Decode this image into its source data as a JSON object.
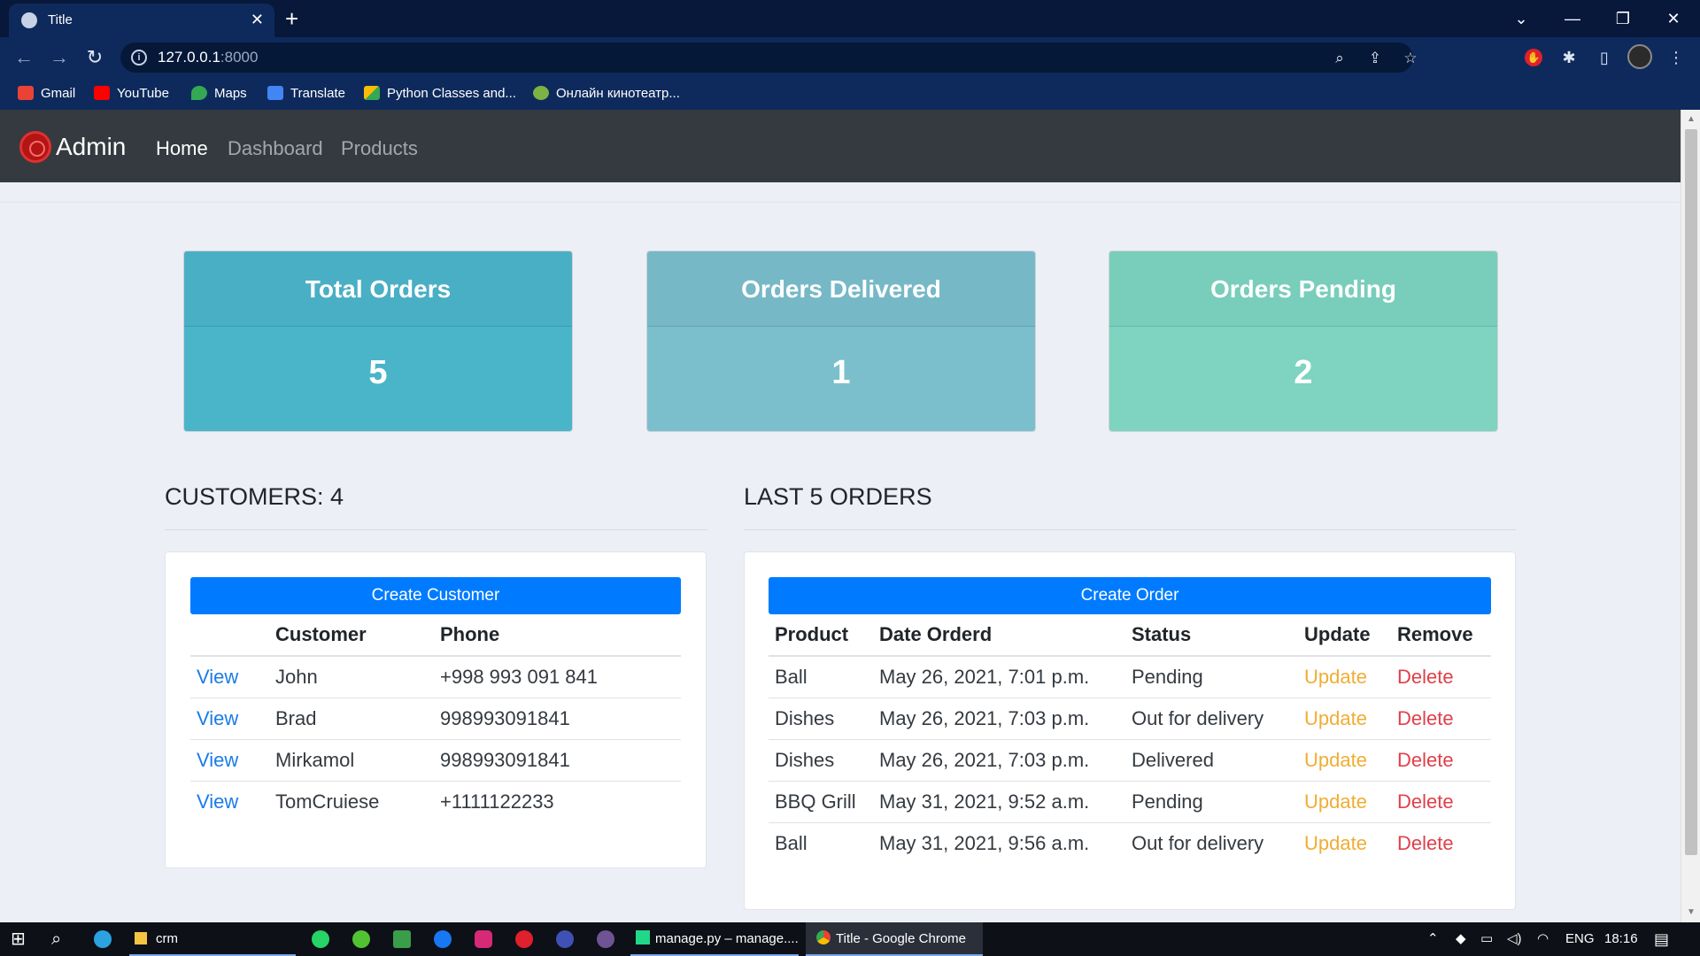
{
  "browser": {
    "tab_title": "Title",
    "tab_close": "✕",
    "new_tab": "+",
    "url_host": "127.0.0.1",
    "url_port": ":8000",
    "window_controls": {
      "dropdown": "⌄",
      "minimize": "—",
      "restore": "❐",
      "close": "✕"
    },
    "bookmarks": [
      {
        "label": "Gmail",
        "icon": "gmail-icon",
        "color": "#ea4335"
      },
      {
        "label": "YouTube",
        "icon": "youtube-icon",
        "color": "#ff0000"
      },
      {
        "label": "Maps",
        "icon": "maps-icon",
        "color": "#34a853"
      },
      {
        "label": "Translate",
        "icon": "translate-icon",
        "color": "#4285f4"
      },
      {
        "label": "Python Classes and...",
        "icon": "python-classes-icon",
        "color": "#fbbc05"
      },
      {
        "label": "Онлайн кинотеатр...",
        "icon": "cinema-icon",
        "color": "#7cb342"
      }
    ]
  },
  "navbar": {
    "brand": "Admin",
    "links": [
      "Home",
      "Dashboard",
      "Products"
    ],
    "active": "Home",
    "bg_color": "#343a40"
  },
  "stats": [
    {
      "title": "Total Orders",
      "value": "5"
    },
    {
      "title": "Orders Delivered",
      "value": "1"
    },
    {
      "title": "Orders Pending",
      "value": "2"
    }
  ],
  "customers": {
    "heading": "CUSTOMERS: 4",
    "create_label": "Create Customer",
    "columns": [
      "",
      "Customer",
      "Phone"
    ],
    "rows": [
      {
        "action": "View",
        "name": "John",
        "phone": "+998 993 091 841"
      },
      {
        "action": "View",
        "name": "Brad",
        "phone": "998993091841"
      },
      {
        "action": "View",
        "name": "Mirkamol",
        "phone": "998993091841"
      },
      {
        "action": "View",
        "name": "TomCruiese",
        "phone": "+1111122233"
      }
    ]
  },
  "orders": {
    "heading": "LAST 5 ORDERS",
    "create_label": "Create Order",
    "columns": [
      "Product",
      "Date Orderd",
      "Status",
      "Update",
      "Remove"
    ],
    "rows": [
      {
        "product": "Ball",
        "date": "May 26, 2021, 7:01 p.m.",
        "status": "Pending",
        "update": "Update",
        "remove": "Delete"
      },
      {
        "product": "Dishes",
        "date": "May 26, 2021, 7:03 p.m.",
        "status": "Out for delivery",
        "update": "Update",
        "remove": "Delete"
      },
      {
        "product": "Dishes",
        "date": "May 26, 2021, 7:03 p.m.",
        "status": "Delivered",
        "update": "Update",
        "remove": "Delete"
      },
      {
        "product": "BBQ Grill",
        "date": "May 31, 2021, 9:52 a.m.",
        "status": "Pending",
        "update": "Update",
        "remove": "Delete"
      },
      {
        "product": "Ball",
        "date": "May 31, 2021, 9:56 a.m.",
        "status": "Out for delivery",
        "update": "Update",
        "remove": "Delete"
      }
    ]
  },
  "colors": {
    "primary": "#007bff",
    "update_link": "#f0ad33",
    "delete_link": "#e0404a",
    "view_link": "#1a7ce8"
  },
  "taskbar": {
    "folder_label": "crm",
    "pycharm_label": "manage.py – manage....",
    "chrome_label": "Title - Google Chrome",
    "language": "ENG",
    "time": "18:16"
  }
}
